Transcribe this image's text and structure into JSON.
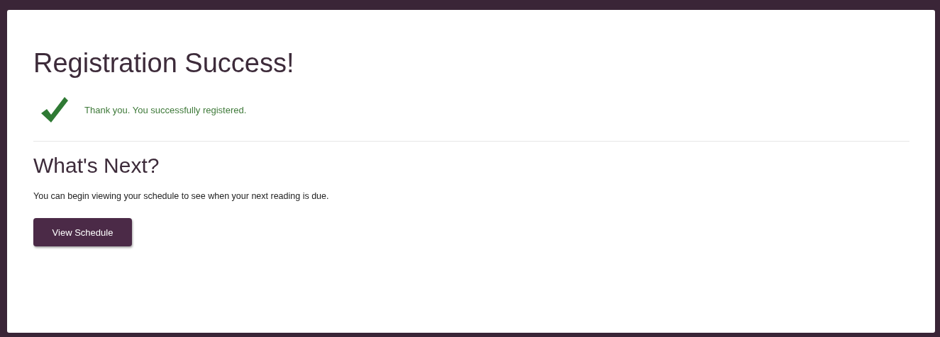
{
  "title": "Registration Success!",
  "message": {
    "kind": "success",
    "text": "Thank you. You successfully registered."
  },
  "next": {
    "heading": "What's Next?",
    "text": "You can begin viewing your schedule to see when your next reading is due.",
    "button": "View Schedule"
  }
}
